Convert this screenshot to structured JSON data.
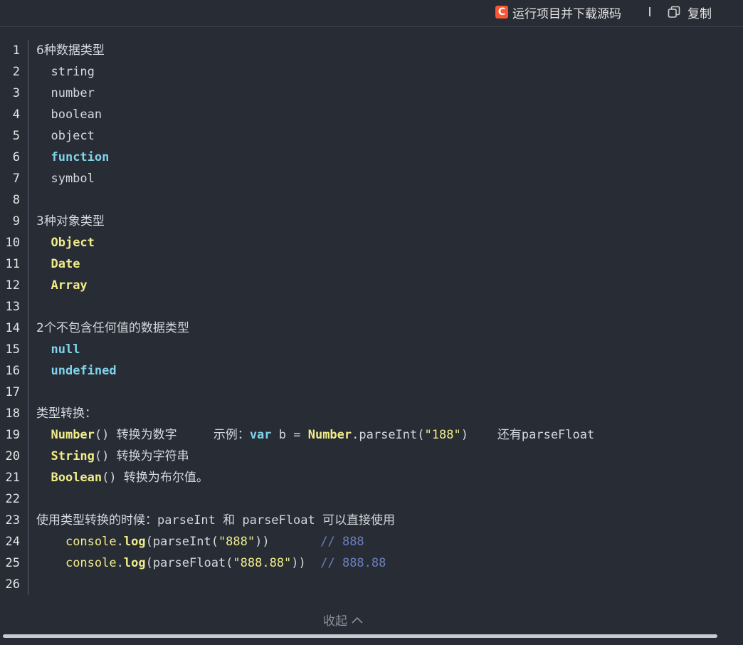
{
  "toolbar": {
    "run_logo": "C",
    "run_label": "运行项目并下载源码",
    "copy_label": "复制"
  },
  "code": {
    "lines": [
      {
        "n": "1",
        "t": [
          [
            "6种数据类型",
            "cjk"
          ]
        ]
      },
      {
        "n": "2",
        "t": [
          [
            "  string",
            ""
          ]
        ]
      },
      {
        "n": "3",
        "t": [
          [
            "  number",
            ""
          ]
        ]
      },
      {
        "n": "4",
        "t": [
          [
            "  boolean",
            ""
          ]
        ]
      },
      {
        "n": "5",
        "t": [
          [
            "  object",
            ""
          ]
        ]
      },
      {
        "n": "6",
        "t": [
          [
            "  ",
            ""
          ],
          [
            "function",
            "kw"
          ]
        ]
      },
      {
        "n": "7",
        "t": [
          [
            "  symbol",
            ""
          ]
        ]
      },
      {
        "n": "8",
        "t": []
      },
      {
        "n": "9",
        "t": [
          [
            "3种对象类型",
            "cjk"
          ]
        ]
      },
      {
        "n": "10",
        "t": [
          [
            "  ",
            ""
          ],
          [
            "Object",
            "ty"
          ]
        ]
      },
      {
        "n": "11",
        "t": [
          [
            "  ",
            ""
          ],
          [
            "Date",
            "ty"
          ]
        ]
      },
      {
        "n": "12",
        "t": [
          [
            "  ",
            ""
          ],
          [
            "Array",
            "ty"
          ]
        ]
      },
      {
        "n": "13",
        "t": []
      },
      {
        "n": "14",
        "t": [
          [
            "2个不包含任何值的数据类型",
            "cjk"
          ]
        ]
      },
      {
        "n": "15",
        "t": [
          [
            "  ",
            ""
          ],
          [
            "null",
            "kw"
          ]
        ]
      },
      {
        "n": "16",
        "t": [
          [
            "  ",
            ""
          ],
          [
            "undefined",
            "kw"
          ]
        ]
      },
      {
        "n": "17",
        "t": []
      },
      {
        "n": "18",
        "t": [
          [
            "类型转换：",
            "cjk"
          ]
        ]
      },
      {
        "n": "19",
        "t": [
          [
            "  ",
            ""
          ],
          [
            "Number",
            "ty"
          ],
          [
            "() ",
            ""
          ],
          [
            "转换为数字",
            "cjk"
          ],
          [
            "     ",
            ""
          ],
          [
            "示例：",
            "cjk"
          ],
          [
            "var",
            "kw"
          ],
          [
            " b = ",
            ""
          ],
          [
            "Number",
            "ty"
          ],
          [
            ".parseInt(",
            ""
          ],
          [
            "\"188\"",
            "str"
          ],
          [
            ")    ",
            ""
          ],
          [
            "还有",
            "cjk"
          ],
          [
            "parseFloat",
            ""
          ]
        ]
      },
      {
        "n": "20",
        "t": [
          [
            "  ",
            ""
          ],
          [
            "String",
            "ty"
          ],
          [
            "() ",
            ""
          ],
          [
            "转换为字符串",
            "cjk"
          ]
        ]
      },
      {
        "n": "21",
        "t": [
          [
            "  ",
            ""
          ],
          [
            "Boolean",
            "ty"
          ],
          [
            "() ",
            ""
          ],
          [
            "转换为布尔值。",
            "cjk"
          ]
        ]
      },
      {
        "n": "22",
        "t": []
      },
      {
        "n": "23",
        "t": [
          [
            "使用类型转换的时候：",
            "cjk"
          ],
          [
            "parseInt ",
            ""
          ],
          [
            "和",
            "cjk"
          ],
          [
            " parseFloat ",
            ""
          ],
          [
            "可以直接使用",
            "cjk"
          ]
        ]
      },
      {
        "n": "24",
        "t": [
          [
            "    ",
            ""
          ],
          [
            "console",
            "fn"
          ],
          [
            ".",
            ""
          ],
          [
            "log",
            "fnb"
          ],
          [
            "(parseInt(",
            ""
          ],
          [
            "\"888\"",
            "str"
          ],
          [
            "))       ",
            ""
          ],
          [
            "// 888",
            "cm"
          ]
        ]
      },
      {
        "n": "25",
        "t": [
          [
            "    ",
            ""
          ],
          [
            "console",
            "fn"
          ],
          [
            ".",
            ""
          ],
          [
            "log",
            "fnb"
          ],
          [
            "(parseFloat(",
            ""
          ],
          [
            "\"888.88\"",
            "str"
          ],
          [
            "))  ",
            ""
          ],
          [
            "// 888.88",
            "cm"
          ]
        ]
      },
      {
        "n": "26",
        "t": []
      }
    ]
  },
  "footer": {
    "collapse_label": "收起"
  }
}
